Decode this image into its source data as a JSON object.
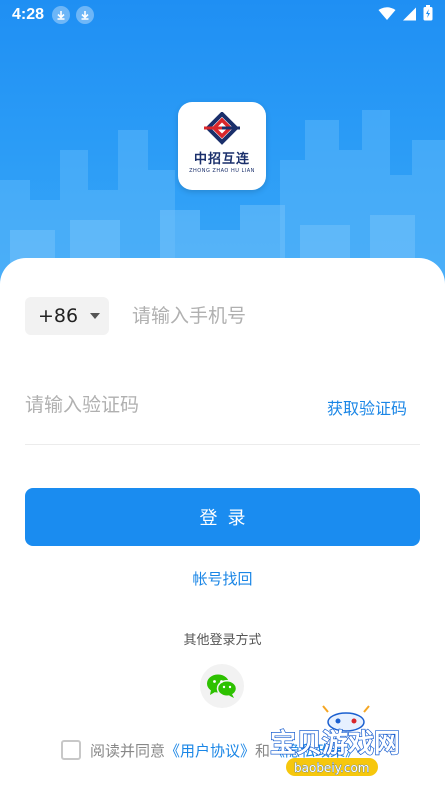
{
  "status_bar": {
    "time": "4:28",
    "icons": [
      "download-icon",
      "download-icon",
      "wifi-icon",
      "signal-icon",
      "battery-charging-icon"
    ]
  },
  "brand": {
    "name_cn": "中招互连",
    "name_en": "ZHONG ZHAO HU LIAN",
    "colors": {
      "hero_blue": "#1f8ff3",
      "primary": "#1a8cf0",
      "link": "#1a86e6",
      "logo_red": "#d9262b",
      "logo_navy": "#1a2f6b"
    }
  },
  "form": {
    "country_code": "+86",
    "phone_placeholder": "请输入手机号",
    "code_placeholder": "请输入验证码",
    "get_code_label": "获取验证码",
    "login_label": "登录",
    "recover_label": "帐号找回"
  },
  "other_login": {
    "label": "其他登录方式",
    "methods": [
      "wechat-icon"
    ]
  },
  "agreement": {
    "prefix": "阅读并同意",
    "user_agreement": "《用户协议》",
    "conjunction": "和",
    "privacy_policy": "《隐私政策》"
  },
  "watermark": {
    "title": "宝贝游戏网",
    "url": "baobeiy.com"
  }
}
